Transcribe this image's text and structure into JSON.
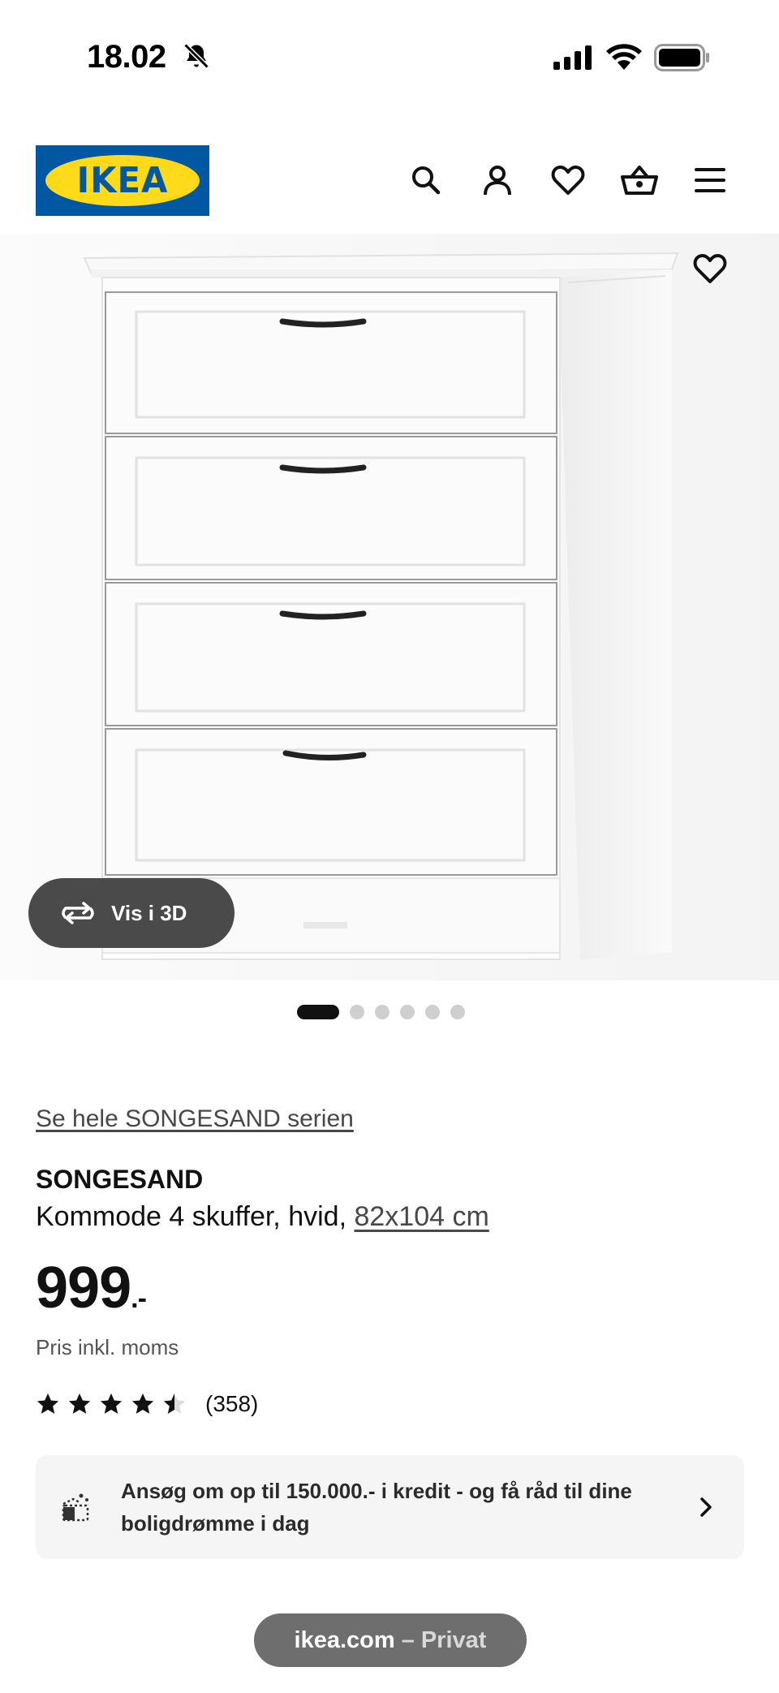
{
  "status_bar": {
    "time": "18.02",
    "icons": [
      "bell-slash-icon",
      "cellular-signal-icon",
      "wifi-icon",
      "battery-icon"
    ]
  },
  "header": {
    "logo_text": "IKEA",
    "brand_colors": {
      "blue": "#0058a3",
      "yellow": "#ffda1a"
    },
    "nav_icons": [
      "search-icon",
      "account-icon",
      "heart-icon",
      "shopping-basket-icon",
      "menu-icon"
    ]
  },
  "gallery": {
    "vis_3d_label": "Vis i 3D",
    "image_count": 6,
    "active_index": 0
  },
  "product": {
    "series_link": "Se hele SONGESAND serien",
    "name": "SONGESAND",
    "description": "Kommode 4 skuffer, hvid, ",
    "dimensions": "82x104 cm",
    "price": "999",
    "price_suffix": ".-",
    "price_note": "Pris inkl. moms",
    "rating": {
      "value": 4.5,
      "max": 5,
      "count_label": "(358)"
    }
  },
  "credit_banner": {
    "text": "Ansøg om op til 150.000.- i kredit - og få råd til dine boligdrømme i dag"
  },
  "browser": {
    "host": "ikea.com",
    "separator": "–",
    "mode": "Privat"
  }
}
